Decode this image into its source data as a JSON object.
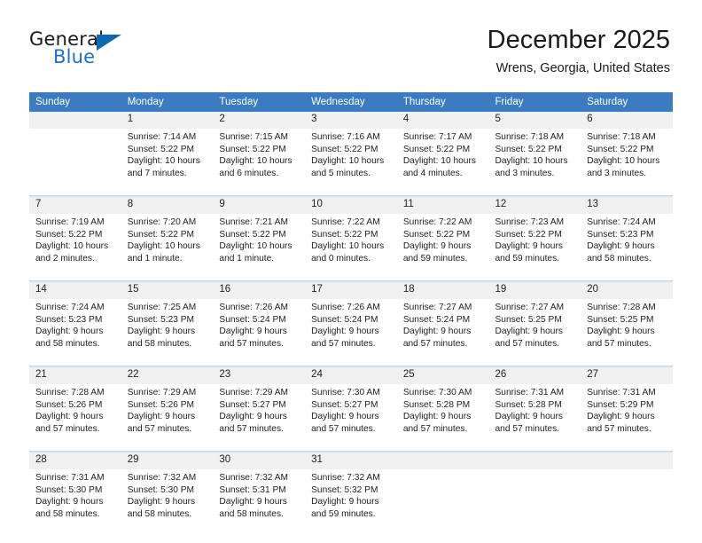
{
  "brand": {
    "name_top": "General",
    "name_bottom": "Blue",
    "accent_color": "#0b69b4"
  },
  "header": {
    "title": "December 2025",
    "subtitle": "Wrens, Georgia, United States"
  },
  "theme": {
    "header_bg": "#3b7cc0",
    "daynum_bg": "#f0f0f0",
    "separator": "#c9d9ea"
  },
  "weekday_headers": [
    "Sunday",
    "Monday",
    "Tuesday",
    "Wednesday",
    "Thursday",
    "Friday",
    "Saturday"
  ],
  "weeks": [
    [
      {
        "day": "",
        "lines": [
          "",
          "",
          "",
          ""
        ]
      },
      {
        "day": "1",
        "lines": [
          "Sunrise: 7:14 AM",
          "Sunset: 5:22 PM",
          "Daylight: 10 hours",
          "and 7 minutes."
        ]
      },
      {
        "day": "2",
        "lines": [
          "Sunrise: 7:15 AM",
          "Sunset: 5:22 PM",
          "Daylight: 10 hours",
          "and 6 minutes."
        ]
      },
      {
        "day": "3",
        "lines": [
          "Sunrise: 7:16 AM",
          "Sunset: 5:22 PM",
          "Daylight: 10 hours",
          "and 5 minutes."
        ]
      },
      {
        "day": "4",
        "lines": [
          "Sunrise: 7:17 AM",
          "Sunset: 5:22 PM",
          "Daylight: 10 hours",
          "and 4 minutes."
        ]
      },
      {
        "day": "5",
        "lines": [
          "Sunrise: 7:18 AM",
          "Sunset: 5:22 PM",
          "Daylight: 10 hours",
          "and 3 minutes."
        ]
      },
      {
        "day": "6",
        "lines": [
          "Sunrise: 7:18 AM",
          "Sunset: 5:22 PM",
          "Daylight: 10 hours",
          "and 3 minutes."
        ]
      }
    ],
    [
      {
        "day": "7",
        "lines": [
          "Sunrise: 7:19 AM",
          "Sunset: 5:22 PM",
          "Daylight: 10 hours",
          "and 2 minutes."
        ]
      },
      {
        "day": "8",
        "lines": [
          "Sunrise: 7:20 AM",
          "Sunset: 5:22 PM",
          "Daylight: 10 hours",
          "and 1 minute."
        ]
      },
      {
        "day": "9",
        "lines": [
          "Sunrise: 7:21 AM",
          "Sunset: 5:22 PM",
          "Daylight: 10 hours",
          "and 1 minute."
        ]
      },
      {
        "day": "10",
        "lines": [
          "Sunrise: 7:22 AM",
          "Sunset: 5:22 PM",
          "Daylight: 10 hours",
          "and 0 minutes."
        ]
      },
      {
        "day": "11",
        "lines": [
          "Sunrise: 7:22 AM",
          "Sunset: 5:22 PM",
          "Daylight: 9 hours",
          "and 59 minutes."
        ]
      },
      {
        "day": "12",
        "lines": [
          "Sunrise: 7:23 AM",
          "Sunset: 5:22 PM",
          "Daylight: 9 hours",
          "and 59 minutes."
        ]
      },
      {
        "day": "13",
        "lines": [
          "Sunrise: 7:24 AM",
          "Sunset: 5:23 PM",
          "Daylight: 9 hours",
          "and 58 minutes."
        ]
      }
    ],
    [
      {
        "day": "14",
        "lines": [
          "Sunrise: 7:24 AM",
          "Sunset: 5:23 PM",
          "Daylight: 9 hours",
          "and 58 minutes."
        ]
      },
      {
        "day": "15",
        "lines": [
          "Sunrise: 7:25 AM",
          "Sunset: 5:23 PM",
          "Daylight: 9 hours",
          "and 58 minutes."
        ]
      },
      {
        "day": "16",
        "lines": [
          "Sunrise: 7:26 AM",
          "Sunset: 5:24 PM",
          "Daylight: 9 hours",
          "and 57 minutes."
        ]
      },
      {
        "day": "17",
        "lines": [
          "Sunrise: 7:26 AM",
          "Sunset: 5:24 PM",
          "Daylight: 9 hours",
          "and 57 minutes."
        ]
      },
      {
        "day": "18",
        "lines": [
          "Sunrise: 7:27 AM",
          "Sunset: 5:24 PM",
          "Daylight: 9 hours",
          "and 57 minutes."
        ]
      },
      {
        "day": "19",
        "lines": [
          "Sunrise: 7:27 AM",
          "Sunset: 5:25 PM",
          "Daylight: 9 hours",
          "and 57 minutes."
        ]
      },
      {
        "day": "20",
        "lines": [
          "Sunrise: 7:28 AM",
          "Sunset: 5:25 PM",
          "Daylight: 9 hours",
          "and 57 minutes."
        ]
      }
    ],
    [
      {
        "day": "21",
        "lines": [
          "Sunrise: 7:28 AM",
          "Sunset: 5:26 PM",
          "Daylight: 9 hours",
          "and 57 minutes."
        ]
      },
      {
        "day": "22",
        "lines": [
          "Sunrise: 7:29 AM",
          "Sunset: 5:26 PM",
          "Daylight: 9 hours",
          "and 57 minutes."
        ]
      },
      {
        "day": "23",
        "lines": [
          "Sunrise: 7:29 AM",
          "Sunset: 5:27 PM",
          "Daylight: 9 hours",
          "and 57 minutes."
        ]
      },
      {
        "day": "24",
        "lines": [
          "Sunrise: 7:30 AM",
          "Sunset: 5:27 PM",
          "Daylight: 9 hours",
          "and 57 minutes."
        ]
      },
      {
        "day": "25",
        "lines": [
          "Sunrise: 7:30 AM",
          "Sunset: 5:28 PM",
          "Daylight: 9 hours",
          "and 57 minutes."
        ]
      },
      {
        "day": "26",
        "lines": [
          "Sunrise: 7:31 AM",
          "Sunset: 5:28 PM",
          "Daylight: 9 hours",
          "and 57 minutes."
        ]
      },
      {
        "day": "27",
        "lines": [
          "Sunrise: 7:31 AM",
          "Sunset: 5:29 PM",
          "Daylight: 9 hours",
          "and 57 minutes."
        ]
      }
    ],
    [
      {
        "day": "28",
        "lines": [
          "Sunrise: 7:31 AM",
          "Sunset: 5:30 PM",
          "Daylight: 9 hours",
          "and 58 minutes."
        ]
      },
      {
        "day": "29",
        "lines": [
          "Sunrise: 7:32 AM",
          "Sunset: 5:30 PM",
          "Daylight: 9 hours",
          "and 58 minutes."
        ]
      },
      {
        "day": "30",
        "lines": [
          "Sunrise: 7:32 AM",
          "Sunset: 5:31 PM",
          "Daylight: 9 hours",
          "and 58 minutes."
        ]
      },
      {
        "day": "31",
        "lines": [
          "Sunrise: 7:32 AM",
          "Sunset: 5:32 PM",
          "Daylight: 9 hours",
          "and 59 minutes."
        ]
      },
      {
        "day": "",
        "lines": [
          "",
          "",
          "",
          ""
        ]
      },
      {
        "day": "",
        "lines": [
          "",
          "",
          "",
          ""
        ]
      },
      {
        "day": "",
        "lines": [
          "",
          "",
          "",
          ""
        ]
      }
    ]
  ]
}
